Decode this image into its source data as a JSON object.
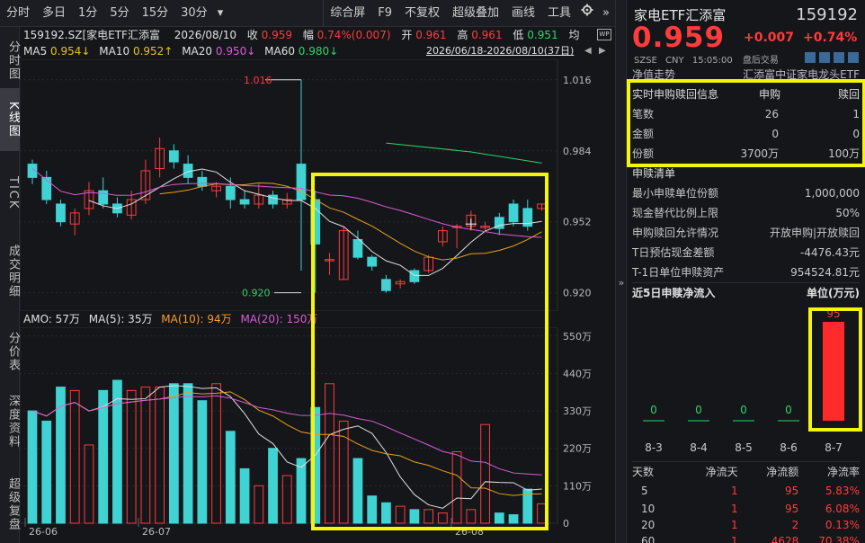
{
  "toolbar": {
    "items": [
      "分时",
      "多日",
      "1分",
      "5分",
      "15分",
      "30分",
      "▾",
      "综合屏",
      "F9",
      "不复权",
      "超级叠加",
      "画线",
      "工具"
    ],
    "expand": "»"
  },
  "vtabs": [
    "分时图",
    "K线图",
    "TICK",
    "成交明细",
    "分价表",
    "深度资料",
    "超级复盘"
  ],
  "quote_line": {
    "code_name": "159192.SZ[家电ETF汇添富",
    "date": "2026/08/10",
    "close_label": "收",
    "close": "0.959",
    "chg_label": "幅",
    "chg": "0.74%(0.007)",
    "open_label": "开",
    "open": "0.961",
    "high_label": "高",
    "high": "0.961",
    "low_label": "低",
    "low": "0.951",
    "avg_label": "均",
    "wp_badge": "WP"
  },
  "ma_line": {
    "ma5": "MA5",
    "ma5_val": "0.954↓",
    "ma10": "MA10",
    "ma10_val": "0.952↑",
    "ma20": "MA20",
    "ma20_val": "0.950↓",
    "ma60": "MA60",
    "ma60_val": "0.980↓",
    "range": "2026/06/18-2026/08/10(37日)"
  },
  "vol_line": {
    "amo": "AMO: 57万",
    "ma5": "MA(5): 35万",
    "ma10": "MA(10): 94万",
    "ma20": "MA(20): 150万"
  },
  "price_axis": [
    "1.016",
    "0.984",
    "0.952",
    "0.920"
  ],
  "vol_axis": [
    "550万",
    "440万",
    "330万",
    "220万",
    "110万",
    "0"
  ],
  "date_axis": [
    "26-06",
    "26-07",
    "26-08"
  ],
  "markers": {
    "high": "1.016",
    "low": "0.920"
  },
  "header": {
    "name": "家电ETF汇添富",
    "code": "159192",
    "price": "0.959",
    "change": "+0.007",
    "change_pct": "+0.74%",
    "exchange": "SZSE",
    "currency": "CNY",
    "time": "15:05:00",
    "session": "盘后交易"
  },
  "section_bar": {
    "left": "净值走势",
    "right": "汇添富中证家电龙头ETF"
  },
  "redeem_info": {
    "headers": [
      "实时申购赎回信息",
      "申购",
      "赎回"
    ],
    "rows": [
      [
        "笔数",
        "26",
        "1"
      ],
      [
        "金额",
        "0",
        "0"
      ],
      [
        "份额",
        "3700万",
        "100万"
      ]
    ]
  },
  "list_section": {
    "title": "申赎清单",
    "rows": [
      [
        "最小申赎单位份额",
        "1,000,000"
      ],
      [
        "现金替代比例上限",
        "50%"
      ],
      [
        "申购赎回允许情况",
        "开放申购|开放赎回"
      ],
      [
        "T日预估现金差额",
        "-4476.43元"
      ],
      [
        "T-1日单位申赎资产",
        "954524.81元"
      ]
    ]
  },
  "flow5": {
    "title": "近5日申赎净流入",
    "unit": "单位(万元)",
    "days": [
      "8-3",
      "8-4",
      "8-5",
      "8-6",
      "8-7"
    ],
    "values": [
      0,
      0,
      0,
      0,
      95
    ],
    "labels": [
      "0",
      "0",
      "0",
      "0",
      "95"
    ]
  },
  "stats": {
    "headers": [
      "天数",
      "净流天",
      "净流额",
      "净流率"
    ],
    "rows": [
      [
        "5",
        "1",
        "95",
        "5.83%"
      ],
      [
        "10",
        "1",
        "95",
        "6.08%"
      ],
      [
        "20",
        "1",
        "2",
        "0.13%"
      ],
      [
        "60",
        "1",
        "4628",
        "70.38%"
      ]
    ]
  },
  "colors": {
    "up": "#ff3b3b",
    "down": "#3fd3d3",
    "ma5": "#e0e0e0",
    "ma10": "#e6a01a",
    "ma20": "#d95cd9",
    "ma60": "#2bd46a",
    "highlight": "#f5f50a"
  }
}
